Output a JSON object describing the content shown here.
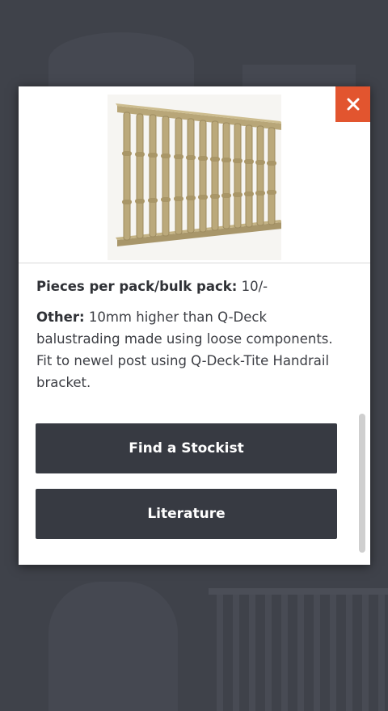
{
  "modal": {
    "close_icon": "close-icon",
    "close_glyph": "✕",
    "image": {
      "alt": "Q-Deck balustrade panel",
      "icon": "product-image"
    },
    "details": [
      {
        "label": "Pieces per pack/bulk pack:",
        "value": "10/-"
      },
      {
        "label": "Other:",
        "value": "10mm higher than Q-Deck balustrading made using loose components. Fit to newel post using Q-Deck-Tite Handrail bracket."
      }
    ],
    "buttons": {
      "stockist_label": "Find a Stockist",
      "literature_label": "Literature"
    }
  },
  "colors": {
    "overlay": "#3f424a",
    "close_bg": "#e2552f",
    "button_bg": "#373a42",
    "text": "#3c3e44"
  }
}
